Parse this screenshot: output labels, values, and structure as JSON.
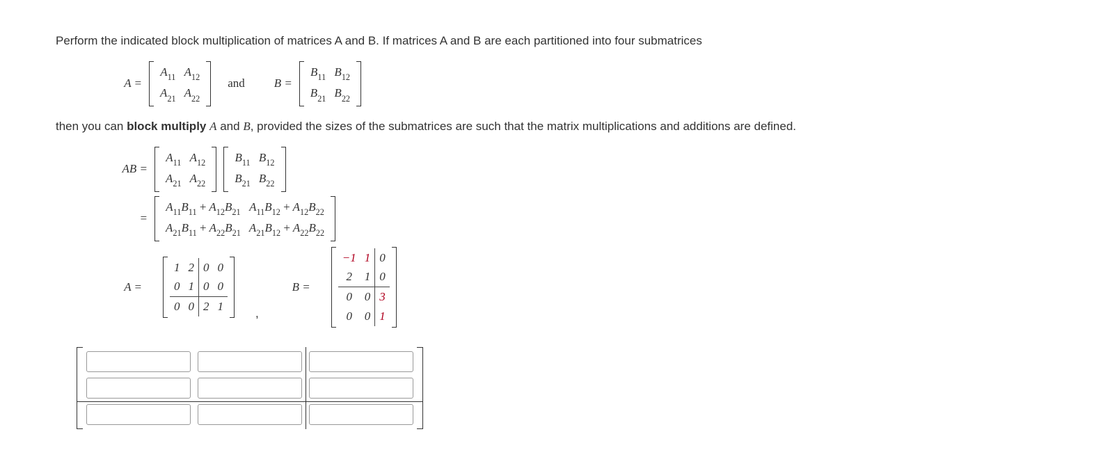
{
  "intro_line1": "Perform the indicated block multiplication of matrices A and B. If matrices A and B are each partitioned into four submatrices",
  "intro_line2": "then you can block multiply A and B, provided the sizes of the submatrices are such that the matrix multiplications and additions are defined.",
  "connect_word": "and",
  "labels": {
    "A_eq": "A =",
    "B_eq": "B =",
    "AB_eq": "AB =",
    "eq": "="
  },
  "block_labels": {
    "A11": "A",
    "A12": "A",
    "A21": "A",
    "A22": "A",
    "B11": "B",
    "B12": "B",
    "B21": "B",
    "B22": "B",
    "s11": "11",
    "s12": "12",
    "s21": "21",
    "s22": "22"
  },
  "formula": {
    "c11": "A11B11 + A12B21",
    "c12": "A11B12 + A12B22",
    "c21": "A21B11 + A22B21",
    "c22": "A21B12 + A22B22"
  },
  "A_numeric": {
    "partition_row": 2,
    "partition_col": 2,
    "rows": [
      [
        "1",
        "2",
        "0",
        "0"
      ],
      [
        "0",
        "1",
        "0",
        "0"
      ],
      [
        "0",
        "0",
        "2",
        "1"
      ]
    ]
  },
  "B_numeric": {
    "partition_row": 2,
    "partition_col": 2,
    "rows": [
      [
        "−1",
        "1",
        "0"
      ],
      [
        "2",
        "1",
        "0"
      ],
      [
        "0",
        "0",
        "3"
      ],
      [
        "0",
        "0",
        "1"
      ]
    ],
    "red_cells": [
      [
        0,
        0
      ],
      [
        0,
        1
      ],
      [
        2,
        2
      ],
      [
        3,
        2
      ]
    ]
  },
  "answer_inputs": {
    "grid_rows": 3,
    "grid_cols": 3,
    "partition_row": 2,
    "partition_col": 2,
    "values": [
      [
        "",
        "",
        ""
      ],
      [
        "",
        "",
        ""
      ],
      [
        "",
        "",
        ""
      ]
    ]
  }
}
